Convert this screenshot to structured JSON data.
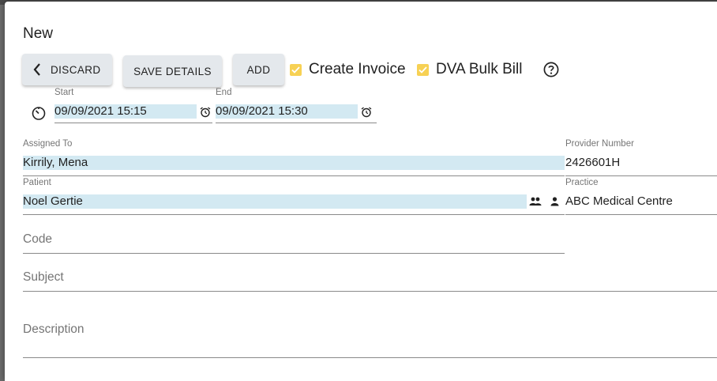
{
  "dialog": {
    "title": "New"
  },
  "toolbar": {
    "discard_label": "DISCARD",
    "save_label": "SAVE DETAILS",
    "add_label": "ADD",
    "create_invoice": {
      "label": "Create Invoice",
      "checked": true
    },
    "dva_bulk_bill": {
      "label": "DVA Bulk Bill",
      "checked": true
    }
  },
  "time": {
    "start": {
      "label": "Start",
      "value": "09/09/2021 15:15"
    },
    "end": {
      "label": "End",
      "value": "09/09/2021 15:30"
    }
  },
  "form": {
    "assigned_to": {
      "label": "Assigned To",
      "value": "Kirrily, Mena"
    },
    "provider_number": {
      "label": "Provider Number",
      "value": "2426601H"
    },
    "patient": {
      "label": "Patient",
      "value": "Noel Gertie"
    },
    "practice": {
      "label": "Practice",
      "value": "ABC Medical Centre"
    },
    "code": {
      "placeholder": "Code"
    },
    "subject": {
      "placeholder": "Subject"
    },
    "description": {
      "placeholder": "Description"
    }
  },
  "colors": {
    "checkbox": "#f7d154",
    "field_highlight": "#d3e9f2",
    "button_bg": "#e4e8ec"
  },
  "icons": [
    "chevron-left-icon",
    "check-icon",
    "help-circle-icon",
    "timer-icon",
    "alarm-clock-icon",
    "people-icon",
    "person-icon"
  ]
}
